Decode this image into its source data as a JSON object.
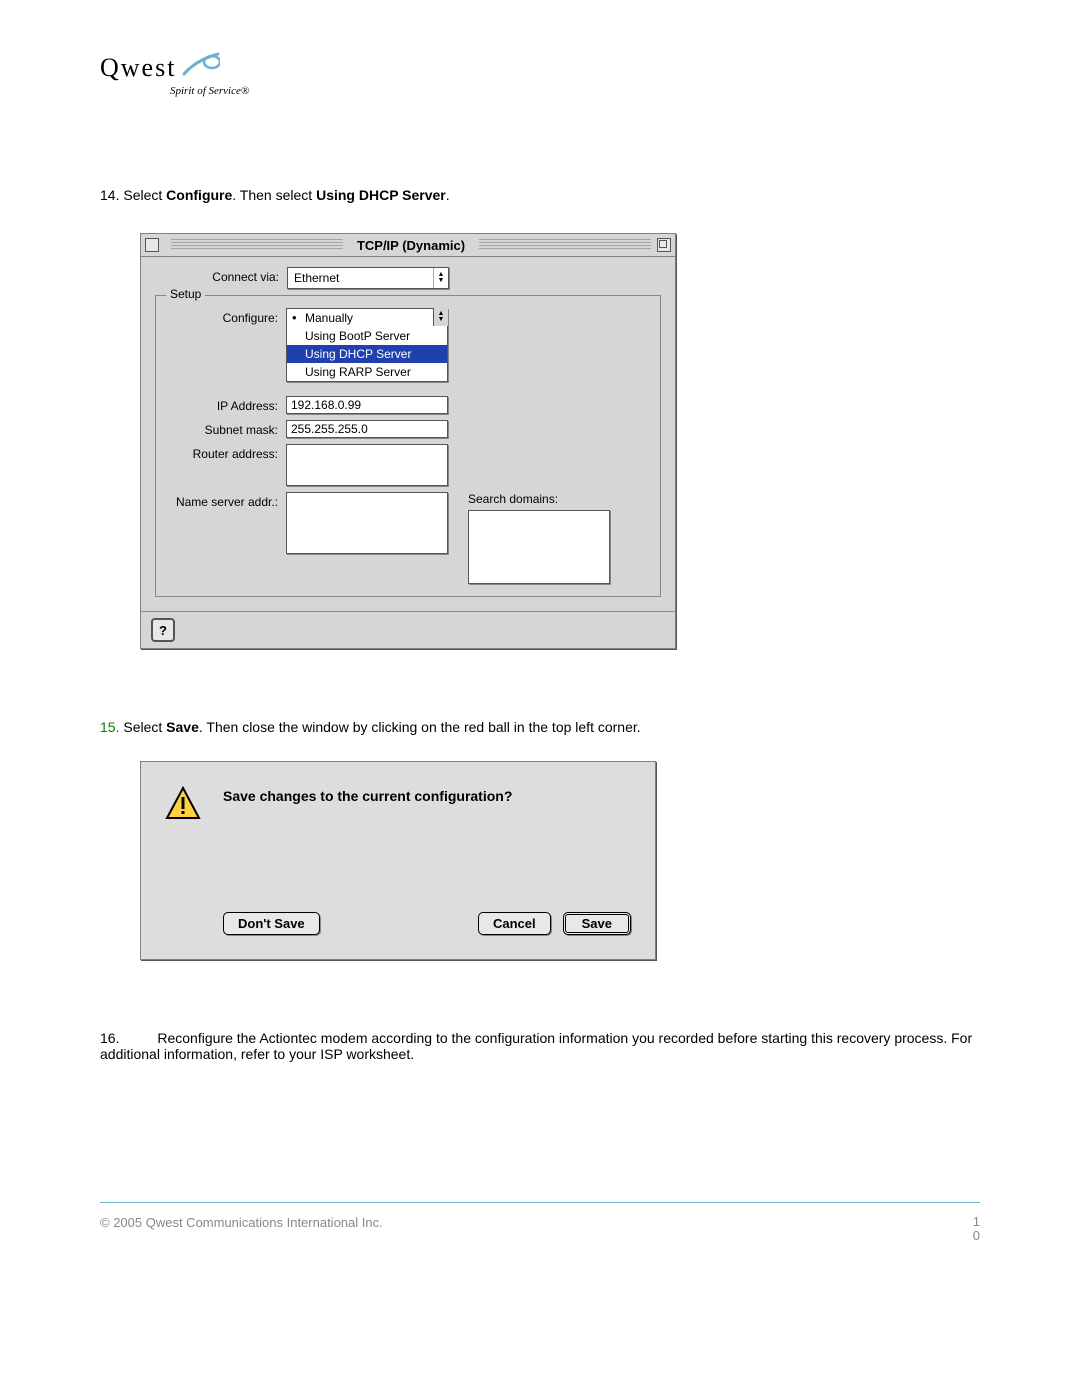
{
  "logo": {
    "brand": "Qwest",
    "tagline": "Spirit of Service®"
  },
  "steps": {
    "s14": {
      "num": "14.",
      "pre": "Select ",
      "b1": "Configure",
      "mid": ". Then select ",
      "b2": "Using DHCP Server",
      "post": "."
    },
    "s15": {
      "num": "15.",
      "pre": "Select ",
      "b1": "Save",
      "post": ". Then close the window by clicking on the red ball in the top left corner."
    },
    "s16": {
      "num": "16.",
      "text": "Reconfigure the Actiontec modem according to the configuration information you recorded before starting this recovery process. For additional information, refer to your ISP worksheet."
    }
  },
  "tcpip": {
    "title": "TCP/IP (Dynamic)",
    "connect_via_label": "Connect via:",
    "connect_via_value": "Ethernet",
    "setup_legend": "Setup",
    "configure_label": "Configure:",
    "configure_options": {
      "o1": "Manually",
      "o2": "Using BootP Server",
      "o3": "Using DHCP Server",
      "o4": "Using RARP Server"
    },
    "ip_label": "IP Address:",
    "ip_value": "192.168.0.99",
    "subnet_label": "Subnet mask:",
    "subnet_value": "255.255.255.0",
    "router_label": "Router address:",
    "ns_label": "Name server addr.:",
    "search_label": "Search domains:",
    "help_glyph": "?"
  },
  "dialog": {
    "message": "Save changes to the current configuration?",
    "dont_save": "Don't Save",
    "cancel": "Cancel",
    "save": "Save"
  },
  "footer": {
    "copyright": "© 2005 Qwest Communications International Inc.",
    "page_top": "1",
    "page_bottom": "0"
  }
}
